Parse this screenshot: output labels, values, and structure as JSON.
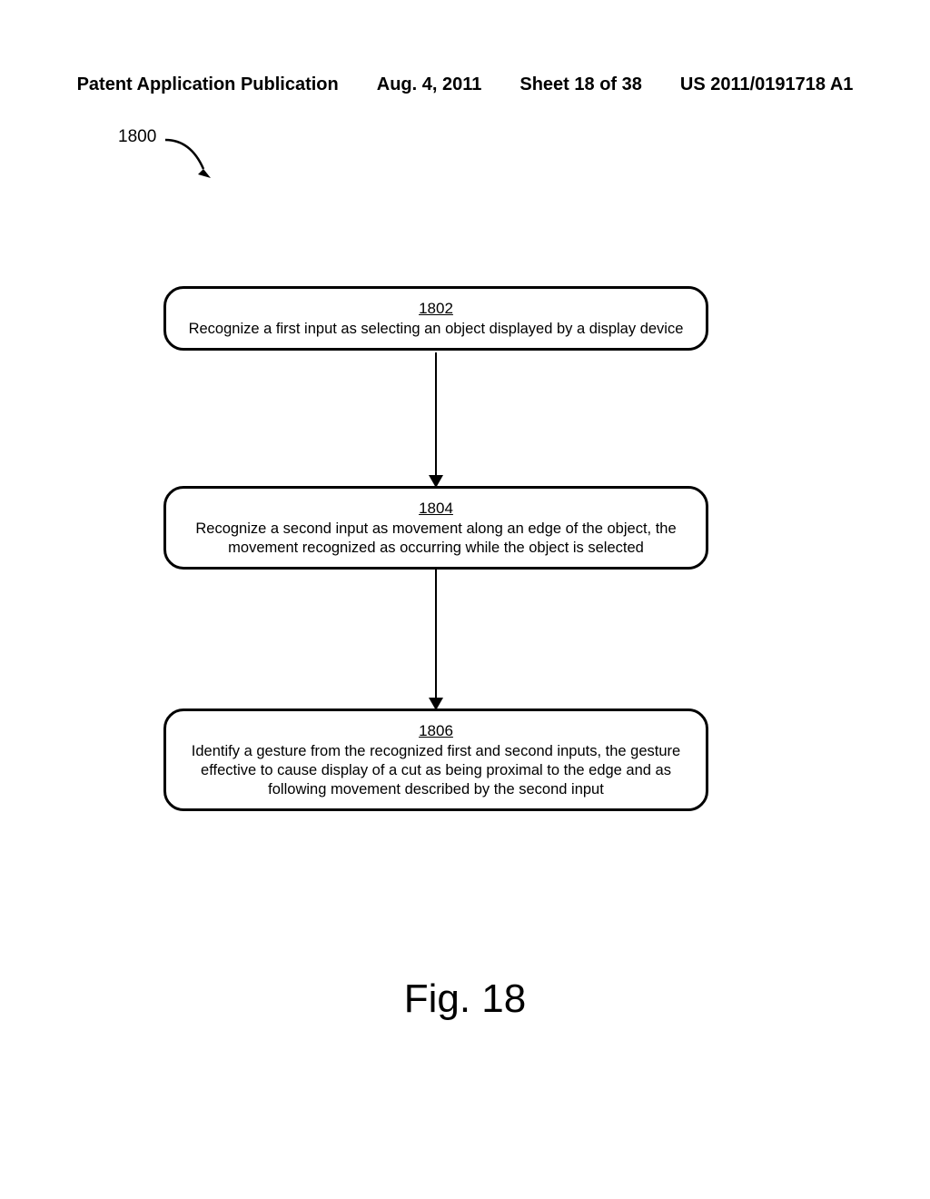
{
  "header": {
    "pub_type": "Patent Application Publication",
    "date": "Aug. 4, 2011",
    "sheet": "Sheet 18 of 38",
    "pub_number": "US 2011/0191718 A1"
  },
  "diagram": {
    "ref_label": "1800",
    "steps": [
      {
        "num": "1802",
        "text": "Recognize a first input as selecting an object displayed by a display device"
      },
      {
        "num": "1804",
        "text": "Recognize a second input as movement along an edge of the object, the movement recognized as occurring while the object is selected"
      },
      {
        "num": "1806",
        "text": "Identify a gesture from the recognized first and second inputs, the gesture effective to cause display of a cut as being proximal to the edge and as following movement described by the second input"
      }
    ]
  },
  "figure_label": "Fig. 18"
}
